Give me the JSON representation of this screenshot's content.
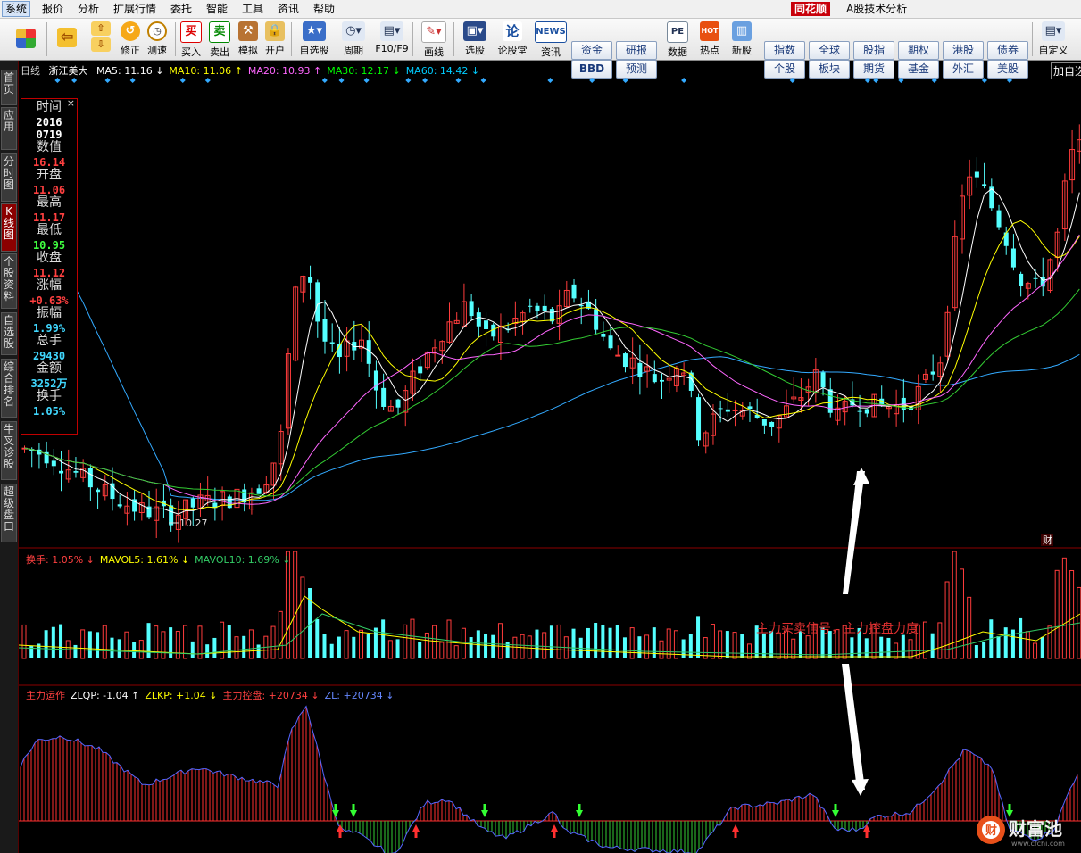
{
  "menu": {
    "items": [
      "系统",
      "报价",
      "分析",
      "扩展行情",
      "委托",
      "智能",
      "工具",
      "资讯",
      "帮助"
    ],
    "brand": "同花顺",
    "title": "A股技术分析"
  },
  "toolbar": {
    "buttons": [
      {
        "label": "修正"
      },
      {
        "label": "测速"
      },
      {
        "label": "买入",
        "icon": "买"
      },
      {
        "label": "卖出",
        "icon": "卖"
      },
      {
        "label": "模拟"
      },
      {
        "label": "开户"
      },
      {
        "label": "自选股"
      },
      {
        "label": "周期"
      },
      {
        "label": "F10/F9"
      },
      {
        "label": "画线"
      },
      {
        "label": "选股"
      },
      {
        "label": "论股堂"
      },
      {
        "label": "资讯",
        "icon": "NEWS"
      },
      {
        "label": "数据",
        "icon": "PE"
      },
      {
        "label": "热点",
        "icon": "HOT"
      },
      {
        "label": "新股"
      },
      {
        "label": "自定义"
      }
    ],
    "grid1": [
      "资金",
      "研报",
      "BBD",
      "预测"
    ],
    "grid2": [
      "指数",
      "全球",
      "股指",
      "期权",
      "港股",
      "债券",
      "个股",
      "板块",
      "期货",
      "基金",
      "外汇",
      "美股"
    ]
  },
  "sidebar": [
    "首页",
    "应用",
    "分时图",
    "K线图",
    "个股资料",
    "自选股",
    "综合排名",
    "牛叉诊股",
    "超级盘口"
  ],
  "main_header": {
    "period": "日线",
    "stock": "浙江美大",
    "ma": [
      {
        "label": "MA5: 11.16",
        "arrow": "↓",
        "color": "#ffffff"
      },
      {
        "label": "MA10: 11.06",
        "arrow": "↑",
        "color": "#ffff00"
      },
      {
        "label": "MA20: 10.93",
        "arrow": "↑",
        "color": "#ff66ff"
      },
      {
        "label": "MA30: 12.17",
        "arrow": "↓",
        "color": "#00ff00"
      },
      {
        "label": "MA60: 14.42",
        "arrow": "↓",
        "color": "#00ccff"
      }
    ],
    "add_btn": "加自选",
    "low_label": "10.27",
    "fin_badge": "财"
  },
  "info_box": {
    "rows": [
      {
        "label": "时间",
        "value": "2016",
        "color": "#ffffff"
      },
      {
        "label": "",
        "value": "0719",
        "color": "#ffffff"
      },
      {
        "label": "数值",
        "value": "16.14",
        "color": "#ff4040"
      },
      {
        "label": "开盘",
        "value": "11.06",
        "color": "#ff4040"
      },
      {
        "label": "最高",
        "value": "11.17",
        "color": "#ff4040"
      },
      {
        "label": "最低",
        "value": "10.95",
        "color": "#40ff40"
      },
      {
        "label": "收盘",
        "value": "11.12",
        "color": "#ff4040"
      },
      {
        "label": "涨幅",
        "value": "+0.63%",
        "color": "#ff4040"
      },
      {
        "label": "振幅",
        "value": "1.99%",
        "color": "#40d8ff"
      },
      {
        "label": "总手",
        "value": "29430",
        "color": "#40d8ff"
      },
      {
        "label": "金额",
        "value": "3252万",
        "color": "#40d8ff"
      },
      {
        "label": "换手",
        "value": "1.05%",
        "color": "#40d8ff"
      }
    ]
  },
  "vol_header": [
    {
      "label": "换手: 1.05%",
      "arrow": "↓",
      "color": "#ff4040"
    },
    {
      "label": "MAVOL5: 1.61%",
      "arrow": "↓",
      "color": "#ffff00"
    },
    {
      "label": "MAVOL10: 1.69%",
      "arrow": "↓",
      "color": "#33cc66"
    }
  ],
  "ind_header": [
    {
      "label": "主力运作",
      "arrow": "",
      "color": "#ff4040"
    },
    {
      "label": "ZLQP: -1.04",
      "arrow": "↑",
      "color": "#ffffff"
    },
    {
      "label": "ZLKP: +1.04",
      "arrow": "↓",
      "color": "#ffff00"
    },
    {
      "label": "主力控盘: +20734",
      "arrow": "↓",
      "color": "#ff4040"
    },
    {
      "label": "ZL: +20734",
      "arrow": "↓",
      "color": "#6688ff"
    }
  ],
  "annotation": "主力买卖信号，主力控盘力度",
  "footer": {
    "brand": "财富池",
    "url": "www.cfchi.com"
  },
  "colors": {
    "up": "#ff3c3c",
    "down": "#54ffff",
    "bg": "#000000",
    "grid": "#8b0000"
  },
  "chart_data": {
    "type": "candlestick",
    "ma_values": {
      "MA5": 11.16,
      "MA10": 11.06,
      "MA20": 10.93,
      "MA30": 12.17,
      "MA60": 14.42
    },
    "y_marks": {
      "low": 10.27
    },
    "indicator": {
      "ZLQP": -1.04,
      "ZLKP": 1.04,
      "主力控盘": 20734,
      "ZL": 20734
    }
  }
}
